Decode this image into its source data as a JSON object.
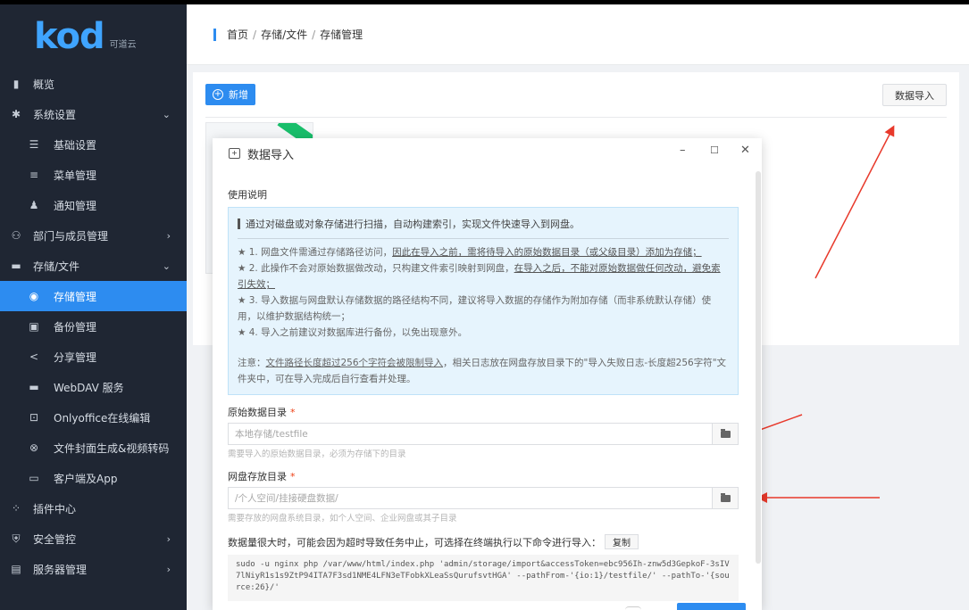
{
  "sidebar": {
    "logo": {
      "text": "kod",
      "sub": "可道云"
    },
    "items": [
      {
        "label": "概览",
        "icon": "bar-chart-icon",
        "glyph": "▮"
      },
      {
        "label": "系统设置",
        "icon": "gear-icon",
        "glyph": "✱",
        "arrow": "⌄"
      },
      {
        "label": "基础设置",
        "icon": "sliders-icon",
        "glyph": "☰"
      },
      {
        "label": "菜单管理",
        "icon": "menu-icon",
        "glyph": "≡"
      },
      {
        "label": "通知管理",
        "icon": "bell-icon",
        "glyph": "♟"
      },
      {
        "label": "部门与成员管理",
        "icon": "users-icon",
        "glyph": "⚇",
        "arrow": "›"
      },
      {
        "label": "存储/文件",
        "icon": "folder-icon",
        "glyph": "▬",
        "arrow": "⌄"
      },
      {
        "label": "存储管理",
        "icon": "database-icon",
        "glyph": "◉"
      },
      {
        "label": "备份管理",
        "icon": "save-icon",
        "glyph": "▣"
      },
      {
        "label": "分享管理",
        "icon": "share-icon",
        "glyph": "<"
      },
      {
        "label": "WebDAV 服务",
        "icon": "webdav-icon",
        "glyph": "▬"
      },
      {
        "label": "Onlyoffice在线编辑",
        "icon": "office-icon",
        "glyph": "⊡"
      },
      {
        "label": "文件封面生成&视频转码",
        "icon": "cover-icon",
        "glyph": "⊗"
      },
      {
        "label": "客户端及App",
        "icon": "monitor-icon",
        "glyph": "▭"
      },
      {
        "label": "插件中心",
        "icon": "plugin-icon",
        "glyph": "⁘"
      },
      {
        "label": "安全管控",
        "icon": "shield-icon",
        "glyph": "⛨",
        "arrow": "›"
      },
      {
        "label": "服务器管理",
        "icon": "server-icon",
        "glyph": "▤",
        "arrow": "›"
      }
    ]
  },
  "breadcrumb": {
    "home": "首页",
    "parent": "存储/文件",
    "current": "存储管理",
    "sep": "/"
  },
  "toolbar": {
    "add_label": "新增",
    "import_label": "数据导入"
  },
  "dialog": {
    "title": "数据导入",
    "min": "–",
    "max": "☐",
    "close": "✕",
    "usage_label": "使用说明",
    "lead": "通过对磁盘或对象存储进行扫描，自动构建索引，实现文件快速导入到网盘。",
    "notes": [
      "★ 1. 网盘文件需通过存储路径访问，",
      "因此在导入之前，需将待导入的原始数据目录（或父级目录）添加为存储；",
      "★ 2. 此操作不会对原始数据做改动，只构建文件索引映射到网盘，",
      "在导入之后，不能对原始数据做任何改动，避免索引失效；",
      "★ 3. 导入数据与网盘默认存储数据的路径结构不同，建议将导入数据的存储作为附加存储（而非系统默认存储）使用，以维护数据结构统一；",
      "★ 4. 导入之前建议对数据库进行备份，以免出现意外。"
    ],
    "warning_prefix": "注意：",
    "warning_underlined": "文件路径长度超过256个字符会被限制导入",
    "warning_rest": "，相关日志放在网盘存放目录下的\"导入失败日志-长度超256字符\"文件夹中，可在导入完成后自行查看并处理。",
    "source_label": "原始数据目录",
    "source_placeholder": "本地存储/testfile",
    "source_hint": "需要导入的原始数据目录，必须为存储下的目录",
    "dest_label": "网盘存放目录",
    "dest_placeholder": "/个人空间/挂接硬盘数据/",
    "dest_hint": "需要存放的网盘系统目录，如个人空间、企业网盘或其子目录",
    "required_mark": "*",
    "cmd_text": "数据量很大时，可能会因为超时导致任务中止，可选择在终端执行以下命令进行导入：",
    "copy_label": "复制",
    "command": "sudo -u nginx php /var/www/html/index.php 'admin/storage/import&accessToken=ebc956Ih-znw5d3GepkoF-3sIV7lNiyR1s1s9ZtP94ITA7F3sd1NME4LFN3eTFobkXLeaSsQurufsvtHGA' --pathFrom-'{io:1}/testfile/' --pathTo-'{source:26}/'"
  },
  "colors": {
    "accent": "#2d8cf0",
    "sidebar_bg": "#1f2633",
    "annotation": "#e8392b"
  }
}
